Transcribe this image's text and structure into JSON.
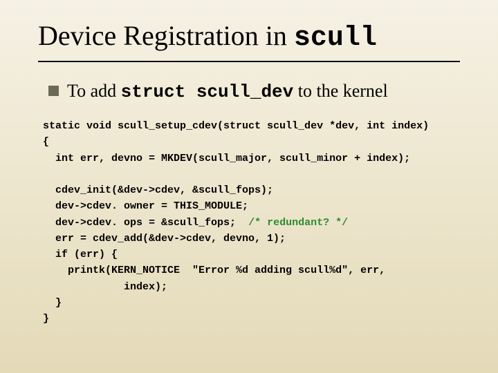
{
  "title_prefix": "Device Registration in ",
  "title_code": "scull",
  "bullet_prefix": "To add ",
  "bullet_code": "struct scull_dev",
  "bullet_suffix": " to the kernel",
  "code_l1": "static void scull_setup_cdev(struct scull_dev *dev, int index)",
  "code_l2": "{",
  "code_l3": "  int err, devno = MKDEV(scull_major, scull_minor + index);",
  "code_l4": "",
  "code_l5": "  cdev_init(&dev->cdev, &scull_fops);",
  "code_l6": "  dev->cdev. owner = THIS_MODULE;",
  "code_l7a": "  dev->cdev. ops = &scull_fops;  ",
  "code_l7b": "/* redundant? */",
  "code_l8": "  err = cdev_add(&dev->cdev, devno, 1);",
  "code_l9": "  if (err) {",
  "code_l10": "    printk(KERN_NOTICE  \"Error %d adding scull%d\", err,",
  "code_l11": "             index);",
  "code_l12": "  }",
  "code_l13": "}"
}
